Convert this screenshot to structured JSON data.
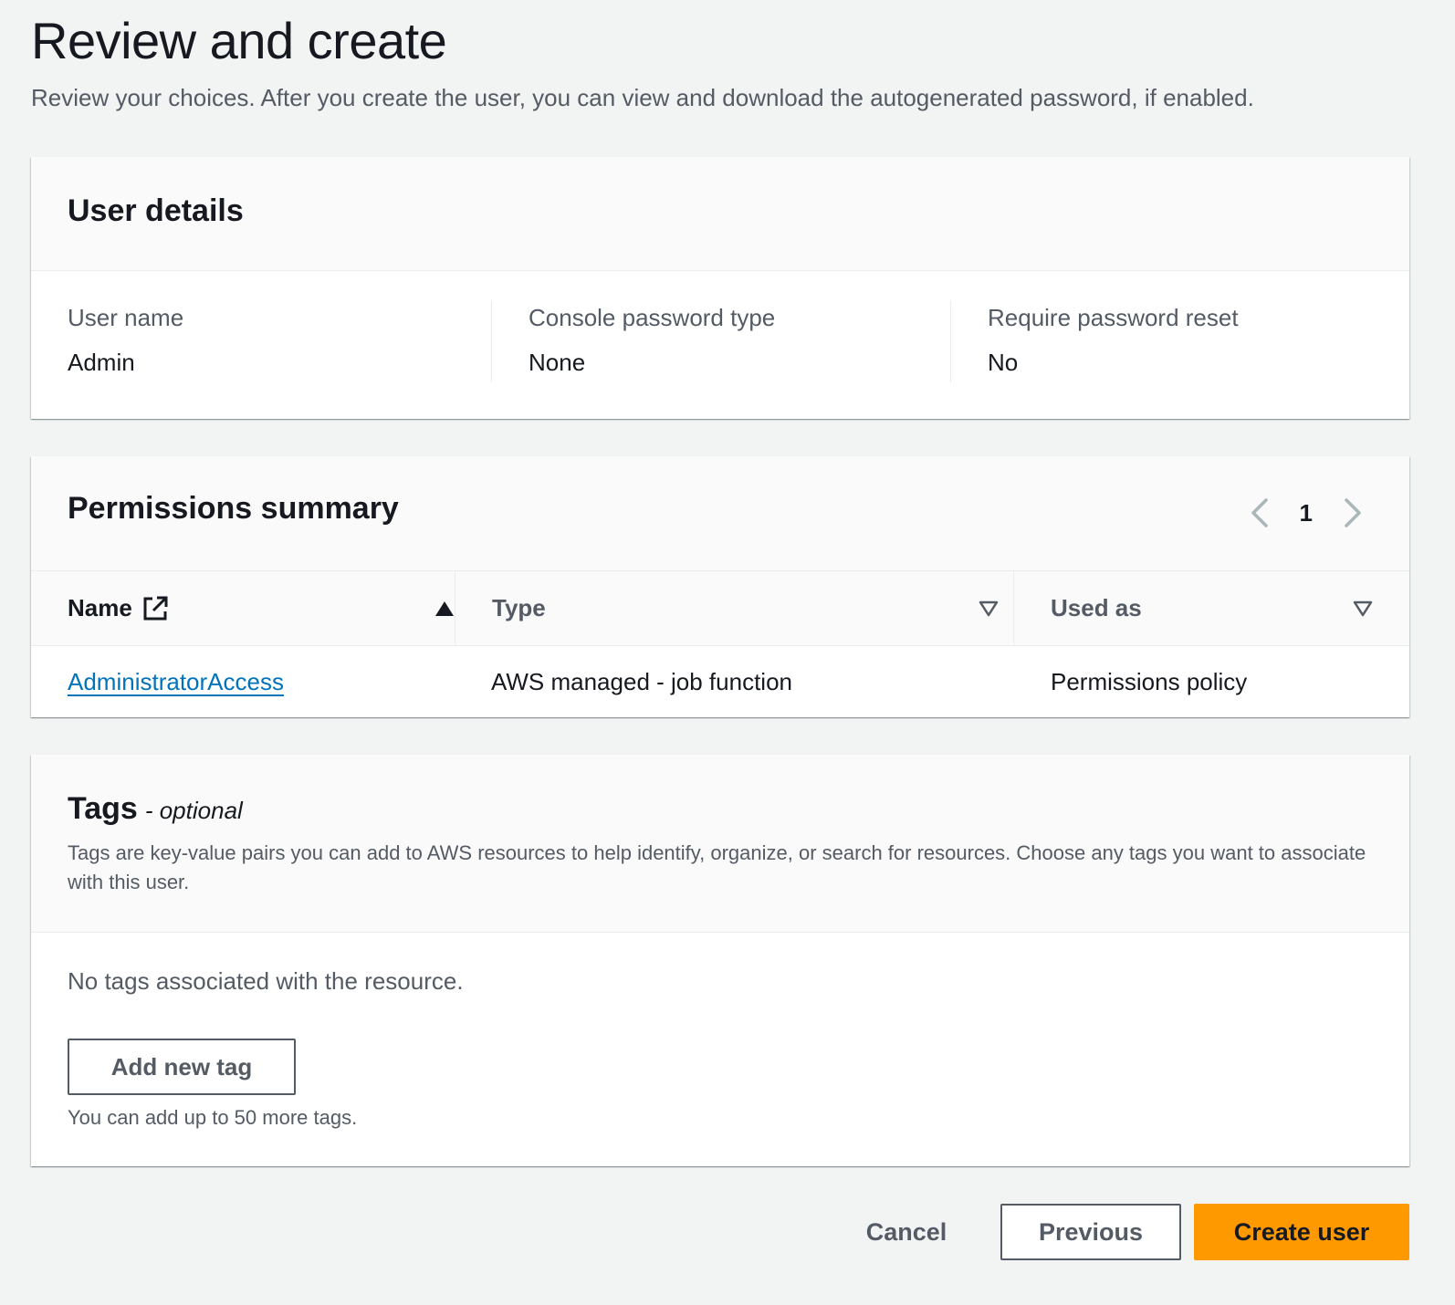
{
  "page": {
    "title": "Review and create",
    "description": "Review your choices. After you create the user, you can view and download the autogenerated password, if enabled."
  },
  "user_details": {
    "title": "User details",
    "fields": [
      {
        "label": "User name",
        "value": "Admin"
      },
      {
        "label": "Console password type",
        "value": "None"
      },
      {
        "label": "Require password reset",
        "value": "No"
      }
    ]
  },
  "permissions": {
    "title": "Permissions summary",
    "pagination": {
      "current_page": "1"
    },
    "columns": [
      {
        "label": "Name",
        "sort": "ascending"
      },
      {
        "label": "Type",
        "sort": "none"
      },
      {
        "label": "Used as",
        "sort": "none"
      }
    ],
    "rows": [
      {
        "name": "AdministratorAccess",
        "type": "AWS managed - job function",
        "used_as": "Permissions policy"
      }
    ]
  },
  "tags": {
    "title": "Tags",
    "optional_label": "- optional",
    "description": "Tags are key-value pairs you can add to AWS resources to help identify, organize, or search for resources. Choose any tags you want to associate with this user.",
    "empty_text": "No tags associated with the resource.",
    "add_button": "Add new tag",
    "hint": "You can add up to 50 more tags."
  },
  "actions": {
    "cancel": "Cancel",
    "previous": "Previous",
    "create": "Create user"
  },
  "colors": {
    "primary_button": "#ff9900",
    "link": "#0073bb",
    "page_background": "#f2f3f3"
  },
  "icons": {
    "prev_page": "chevron-left-icon",
    "next_page": "chevron-right-icon",
    "external_link": "external-link-icon",
    "sort_ascending": "sort-ascending-icon",
    "sort_none": "sort-descending-outline-icon"
  }
}
